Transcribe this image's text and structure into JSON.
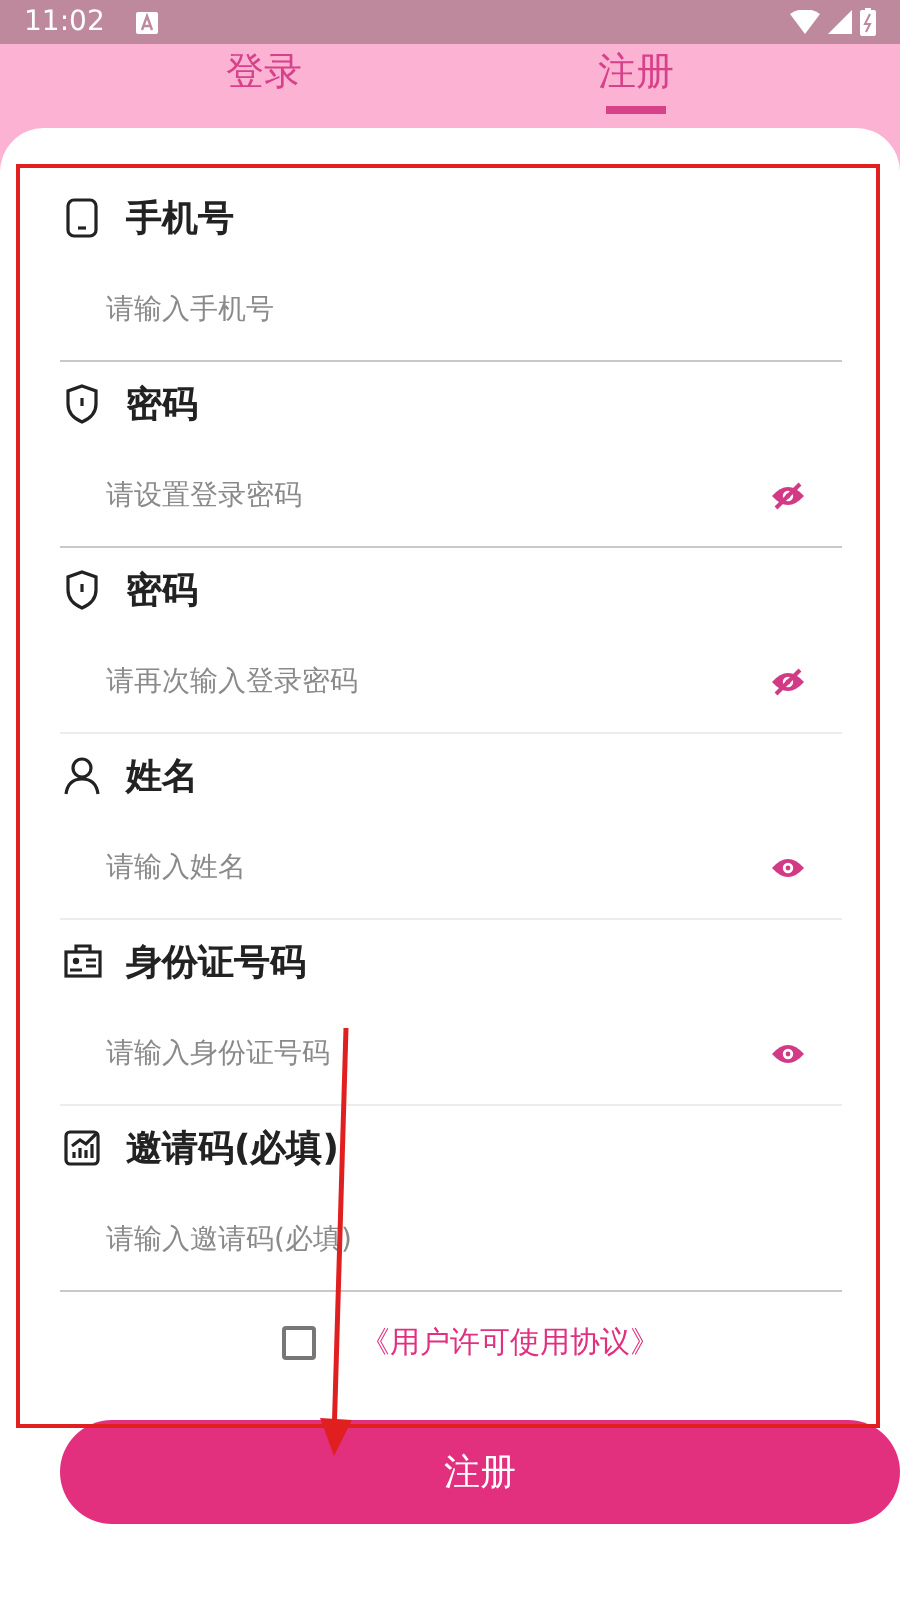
{
  "status_bar": {
    "time": "11:02"
  },
  "tabs": [
    {
      "label": "登录",
      "selected": false
    },
    {
      "label": "注册",
      "selected": true
    }
  ],
  "fields": [
    {
      "kind": "phone",
      "label": "手机号",
      "placeholder": "请输入手机号"
    },
    {
      "kind": "shield",
      "label": "密码",
      "placeholder": "请设置登录密码",
      "visible": false
    },
    {
      "kind": "shield",
      "label": "密码",
      "placeholder": "请再次输入登录密码",
      "visible": false
    },
    {
      "kind": "person",
      "label": "姓名",
      "placeholder": "请输入姓名",
      "visible": true
    },
    {
      "kind": "idcard",
      "label": "身份证号码",
      "placeholder": "请输入身份证号码",
      "visible": true
    },
    {
      "kind": "chart",
      "label": "邀请码(必填)",
      "placeholder": "请输入邀请码(必填)"
    }
  ],
  "agreement": {
    "checked": false,
    "link": "《用户许可使用协议》"
  },
  "submit": "注册"
}
